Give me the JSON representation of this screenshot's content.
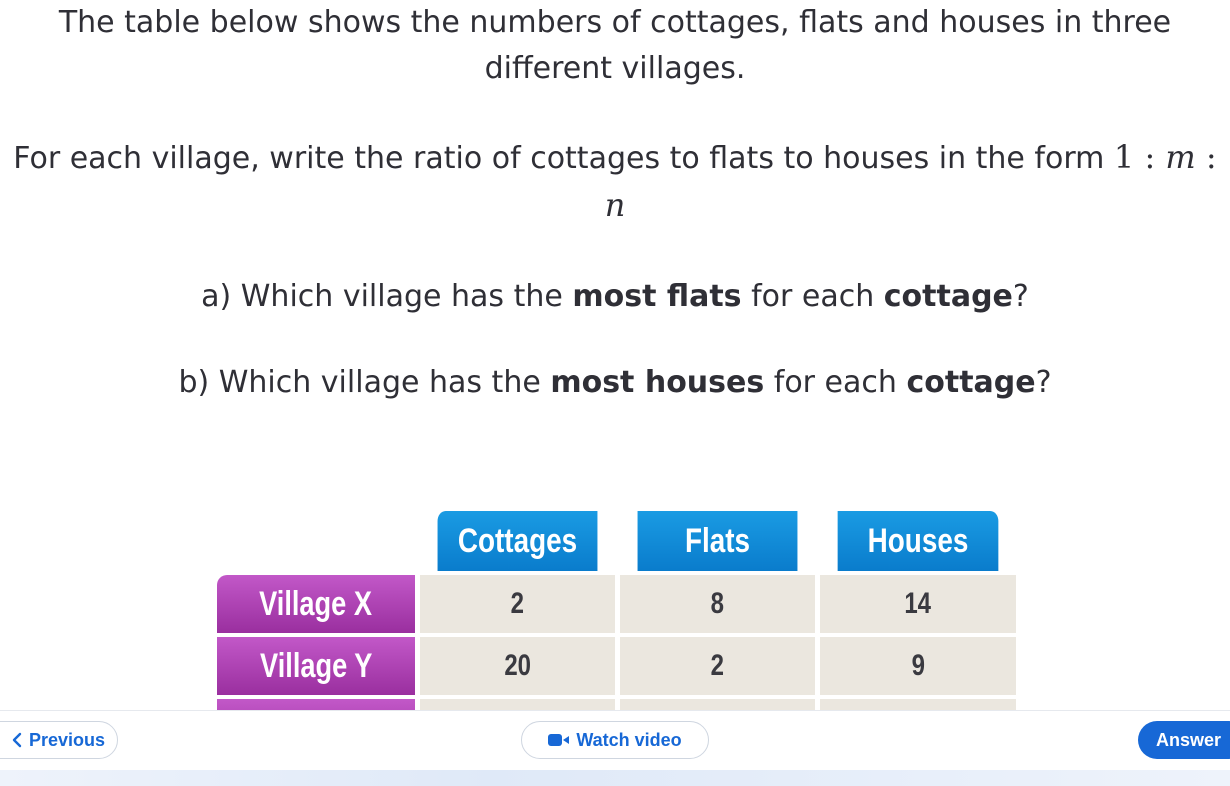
{
  "question": {
    "intro": "The table below shows the numbers of cottages, flats and houses in three different villages.",
    "instruction_text": "For each village, write the ratio of cottages to flats to houses in the form",
    "formula": {
      "one": "1",
      "colon": ":",
      "m": "m",
      "n": "n"
    },
    "part_a": {
      "prefix": "a) Which village has the ",
      "bold1": "most flats",
      "mid": " for each ",
      "bold2": "cottage",
      "suffix": "?"
    },
    "part_b": {
      "prefix": "b) Which village has the ",
      "bold1": "most houses",
      "mid": " for each ",
      "bold2": "cottage",
      "suffix": "?"
    }
  },
  "table": {
    "headers": [
      "Cottages",
      "Flats",
      "Houses"
    ],
    "rows": [
      {
        "label": "Village X",
        "values": [
          "2",
          "8",
          "14"
        ]
      },
      {
        "label": "Village Y",
        "values": [
          "20",
          "2",
          "9"
        ]
      }
    ],
    "colors": {
      "header": "#0a88d6",
      "row_label": "#a63aab",
      "cell": "#ebe7df"
    }
  },
  "nav": {
    "previous_label": "Previous",
    "watch_video_label": "Watch video",
    "answer_label": "Answer",
    "icons": {
      "previous": "chevron-left-icon",
      "video": "video-camera-icon"
    },
    "accent": "#1768d6"
  }
}
